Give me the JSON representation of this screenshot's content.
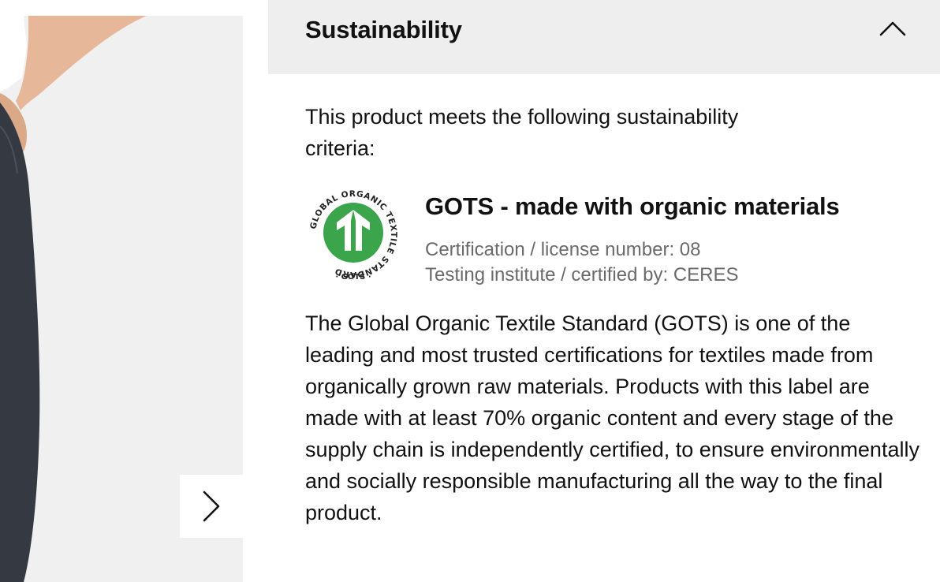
{
  "gallery": {
    "next_icon": "chevron-right-icon"
  },
  "accordion": {
    "title": "Sustainability",
    "toggle_icon": "chevron-up-icon",
    "expanded": true,
    "intro": "This product meets the following sustainability criteria:",
    "certification": {
      "logo_icon": "gots-logo-icon",
      "logo_ring_text": "GLOBAL ORGANIC TEXTILE STANDARD",
      "logo_bottom_text": "· GOTS ·",
      "logo_color": "#3aa54a",
      "title": "GOTS - made with organic materials",
      "license_line": "Certification / license number: 08",
      "institute_line": "Testing institute / certified by: CERES"
    },
    "description": "The Global Organic Textile Standard (GOTS) is one of the leading and most trusted certifications for textiles made from organically grown raw materials. Products with this label are made with at least 70% organic content and every stage of the supply chain is independently certified, to ensure environmentally and socially responsible manufacturing all the way to the final product."
  }
}
